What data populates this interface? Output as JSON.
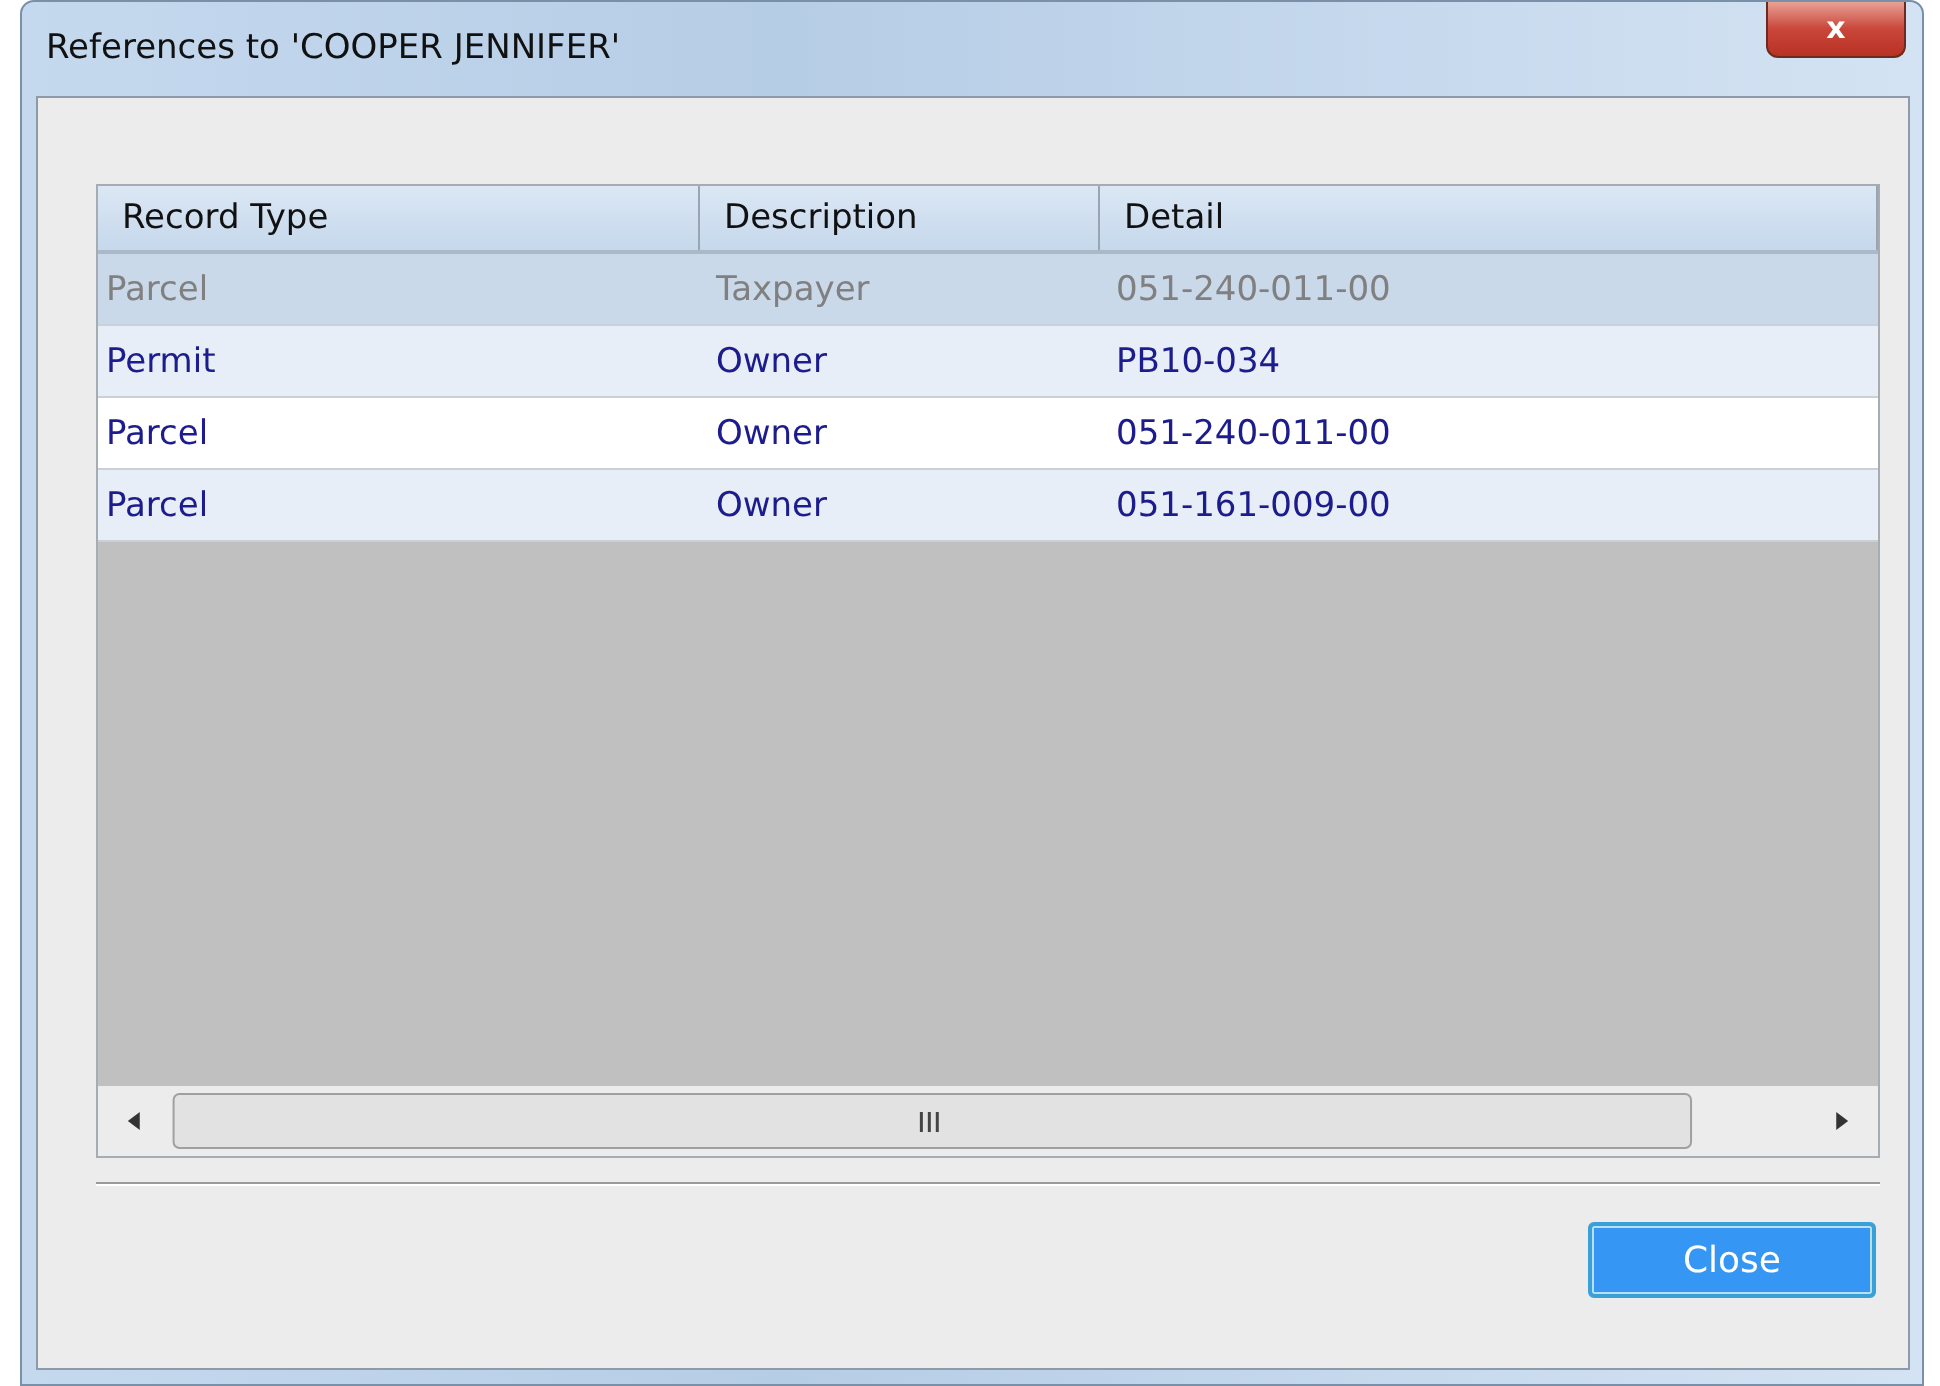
{
  "window": {
    "title": "References to 'COOPER JENNIFER'",
    "close_glyph": "x"
  },
  "table": {
    "columns": [
      "Record Type",
      "Description",
      "Detail"
    ],
    "rows": [
      {
        "cells": [
          "Parcel",
          "Taxpayer",
          "051-240-011-00"
        ],
        "selected": true
      },
      {
        "cells": [
          "Permit",
          "Owner",
          "PB10-034"
        ],
        "selected": false
      },
      {
        "cells": [
          "Parcel",
          "Owner",
          "051-240-011-00"
        ],
        "selected": false
      },
      {
        "cells": [
          "Parcel",
          "Owner",
          "051-161-009-00"
        ],
        "selected": false
      }
    ]
  },
  "buttons": [
    {
      "label": "Close"
    }
  ]
}
